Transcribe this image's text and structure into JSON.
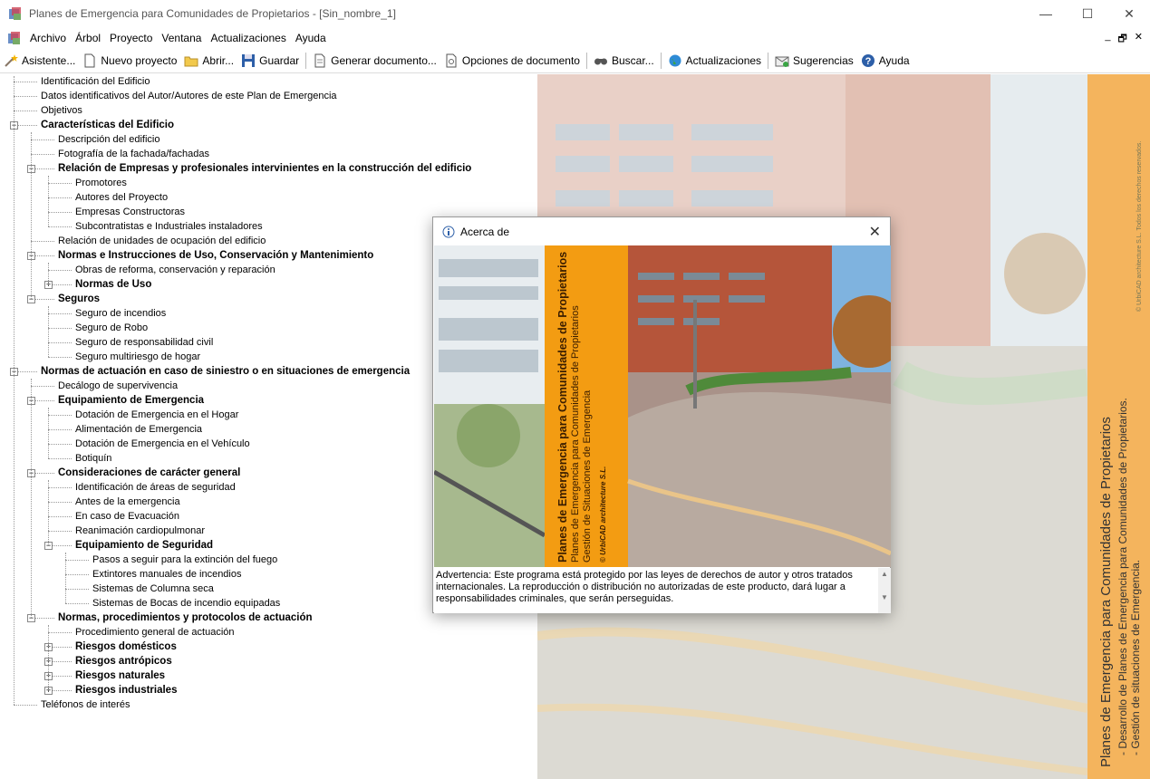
{
  "window": {
    "title": "Planes de Emergencia para Comunidades de Propietarios - [Sin_nombre_1]",
    "controls": {
      "minimize": "—",
      "maximize": "☐",
      "close": "✕"
    }
  },
  "menu": {
    "items": [
      "Archivo",
      "Árbol",
      "Proyecto",
      "Ventana",
      "Actualizaciones",
      "Ayuda"
    ],
    "mdi_controls": [
      "_",
      "🗗",
      "✕"
    ]
  },
  "toolbar": {
    "assistant": "Asistente...",
    "new_project": "Nuevo proyecto",
    "open": "Abrir...",
    "save": "Guardar",
    "generate": "Generar documento...",
    "doc_options": "Opciones de documento",
    "search": "Buscar...",
    "updates": "Actualizaciones",
    "suggestions": "Sugerencias",
    "help": "Ayuda"
  },
  "tree": [
    {
      "label": "Identificación del Edificio",
      "level": 0,
      "bold": false
    },
    {
      "label": "Datos identificativos del Autor/Autores de este Plan de Emergencia",
      "level": 0,
      "bold": false
    },
    {
      "label": "Objetivos",
      "level": 0,
      "bold": false
    },
    {
      "label": "Características del Edificio",
      "level": 0,
      "bold": true,
      "expander": "−"
    },
    {
      "label": "Descripción del edificio",
      "level": 1,
      "bold": false
    },
    {
      "label": "Fotografía de la fachada/fachadas",
      "level": 1,
      "bold": false
    },
    {
      "label": "Relación de Empresas y profesionales intervinientes en la construcción del edificio",
      "level": 1,
      "bold": true,
      "expander": "−"
    },
    {
      "label": "Promotores",
      "level": 2,
      "bold": false
    },
    {
      "label": "Autores del Proyecto",
      "level": 2,
      "bold": false
    },
    {
      "label": "Empresas Constructoras",
      "level": 2,
      "bold": false
    },
    {
      "label": "Subcontratistas e Industriales instaladores",
      "level": 2,
      "bold": false
    },
    {
      "label": "Relación de unidades de ocupación del edificio",
      "level": 1,
      "bold": false
    },
    {
      "label": "Normas e Instrucciones de Uso, Conservación y Mantenimiento",
      "level": 1,
      "bold": true,
      "expander": "−"
    },
    {
      "label": "Obras de reforma, conservación y reparación",
      "level": 2,
      "bold": false
    },
    {
      "label": "Normas de Uso",
      "level": 2,
      "bold": true,
      "expander": "+"
    },
    {
      "label": "Seguros",
      "level": 1,
      "bold": true,
      "expander": "−"
    },
    {
      "label": "Seguro de incendios",
      "level": 2,
      "bold": false
    },
    {
      "label": "Seguro de Robo",
      "level": 2,
      "bold": false
    },
    {
      "label": "Seguro de responsabilidad civil",
      "level": 2,
      "bold": false
    },
    {
      "label": "Seguro multiriesgo de hogar",
      "level": 2,
      "bold": false
    },
    {
      "label": "Normas de actuación en caso de siniestro o en situaciones de emergencia",
      "level": 0,
      "bold": true,
      "expander": "−"
    },
    {
      "label": "Decálogo de supervivencia",
      "level": 1,
      "bold": false
    },
    {
      "label": "Equipamiento de Emergencia",
      "level": 1,
      "bold": true,
      "expander": "−"
    },
    {
      "label": "Dotación de Emergencia en el Hogar",
      "level": 2,
      "bold": false
    },
    {
      "label": "Alimentación de Emergencia",
      "level": 2,
      "bold": false
    },
    {
      "label": "Dotación de Emergencia en el Vehículo",
      "level": 2,
      "bold": false
    },
    {
      "label": "Botiquín",
      "level": 2,
      "bold": false
    },
    {
      "label": "Consideraciones de carácter general",
      "level": 1,
      "bold": true,
      "expander": "−"
    },
    {
      "label": "Identificación de áreas de seguridad",
      "level": 2,
      "bold": false
    },
    {
      "label": "Antes de la emergencia",
      "level": 2,
      "bold": false
    },
    {
      "label": "En caso de Evacuación",
      "level": 2,
      "bold": false
    },
    {
      "label": "Reanimación cardiopulmonar",
      "level": 2,
      "bold": false
    },
    {
      "label": "Equipamiento de Seguridad",
      "level": 2,
      "bold": true,
      "expander": "−"
    },
    {
      "label": "Pasos a seguir para la extinción del fuego",
      "level": 3,
      "bold": false
    },
    {
      "label": "Extintores manuales de incendios",
      "level": 3,
      "bold": false
    },
    {
      "label": "Sistemas de Columna seca",
      "level": 3,
      "bold": false
    },
    {
      "label": "Sistemas de Bocas de incendio equipadas",
      "level": 3,
      "bold": false
    },
    {
      "label": "Normas, procedimientos y protocolos de actuación",
      "level": 1,
      "bold": true,
      "expander": "−"
    },
    {
      "label": "Procedimiento general de actuación",
      "level": 2,
      "bold": false
    },
    {
      "label": "Riesgos domésticos",
      "level": 2,
      "bold": true,
      "expander": "+"
    },
    {
      "label": "Riesgos antrópicos",
      "level": 2,
      "bold": true,
      "expander": "+"
    },
    {
      "label": "Riesgos naturales",
      "level": 2,
      "bold": true,
      "expander": "+"
    },
    {
      "label": "Riesgos industriales",
      "level": 2,
      "bold": true,
      "expander": "+"
    },
    {
      "label": "Teléfonos de interés",
      "level": 0,
      "bold": false
    }
  ],
  "sidebar": {
    "title": "Planes de Emergencia para Comunidades de Propietarios",
    "line1": "- Desarrollo de Planes de Emergencia para Comunidades de Propietarios.",
    "line2": "- Gestión de situaciones de Emergencia.",
    "copyright": "© UrbiCAD architecture S.L. Todos los derechos reservados."
  },
  "dialog": {
    "title": "Acerca de",
    "close": "✕",
    "banner_title": "Planes de Emergencia para Comunidades de Propietarios",
    "banner_line1": "Planes de Emergencia para Comunidades de Propietarios",
    "banner_line2": "Gestión de Situaciones de Emergencia",
    "banner_copyright": "© UrbiCAD architecture S.L.",
    "warning": "Advertencia: Este programa está protegido por las leyes de derechos de autor y otros tratados internacionales. La reproducción o distribución no autorizadas de este producto, dará lugar a responsabilidades criminales, que serán perseguidas."
  },
  "colors": {
    "accent": "#f39c12",
    "sidebar": "#f4b45d",
    "brick": "#b5553a"
  }
}
